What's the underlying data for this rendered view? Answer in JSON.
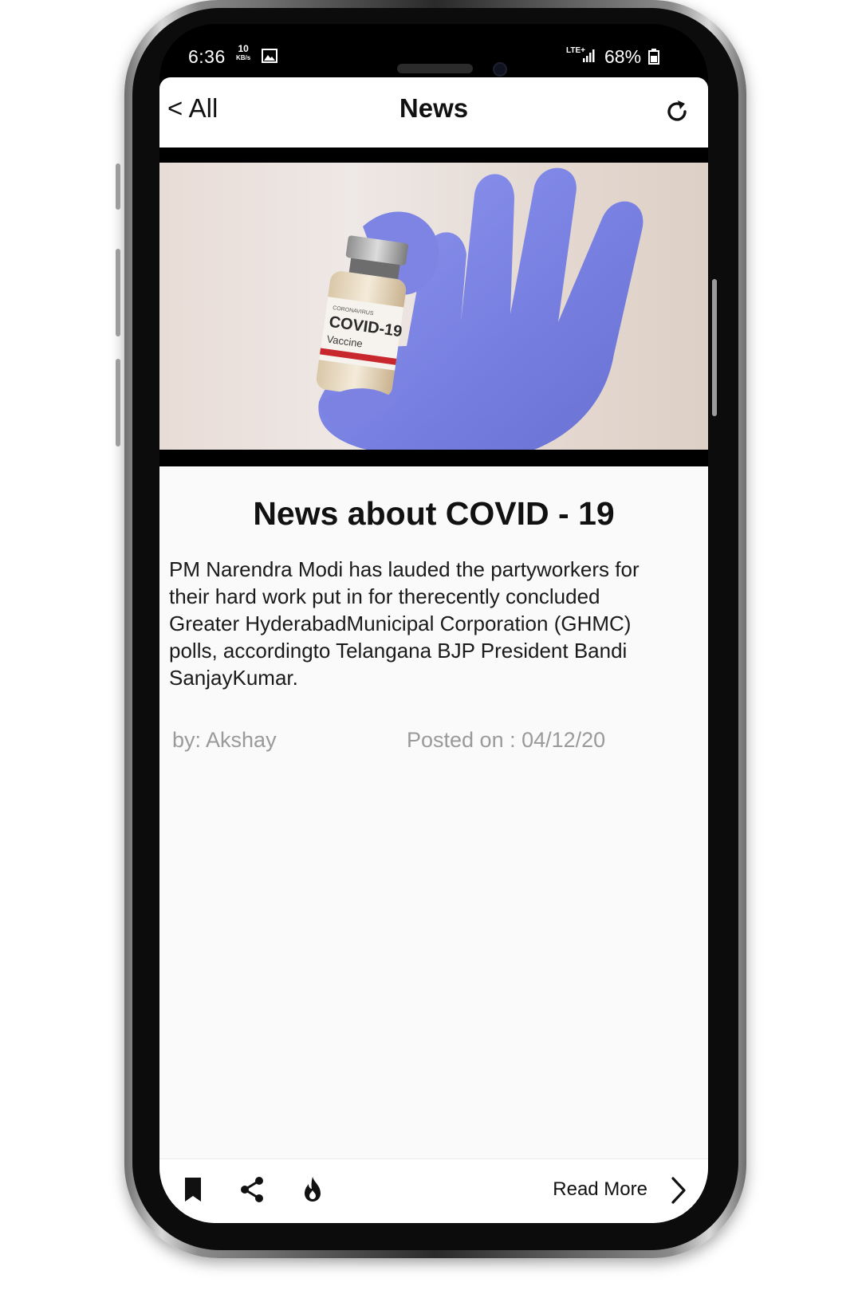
{
  "status_bar": {
    "time": "6:36",
    "speed_value": "10",
    "speed_unit": "KB/s",
    "network": "LTE+",
    "battery": "68%"
  },
  "app_bar": {
    "back_label": "< All",
    "title": "News",
    "refresh_icon": "refresh-icon"
  },
  "article": {
    "image_subject": "COVID-19 Vaccine",
    "vial_label_top": "CORONAVIRUS",
    "vial_label_main": "COVID-19",
    "vial_label_sub": "Vaccine",
    "headline": "News about COVID - 19",
    "body": "PM Narendra Modi has lauded the partyworkers for their hard work put in for therecently concluded Greater HyderabadMunicipal Corporation (GHMC) polls, accordingto Telangana BJP President Bandi SanjayKumar.",
    "author": "by: Akshay",
    "posted": "Posted on : 04/12/20"
  },
  "bottom_bar": {
    "bookmark_icon": "bookmark-icon",
    "share_icon": "share-icon",
    "fire_icon": "fire-icon",
    "read_more": "Read More",
    "chevron_icon": "chevron-right-icon"
  },
  "colors": {
    "glove": "#7f86e6",
    "frame": "#0c0c0c",
    "card_bg": "#fafafa",
    "meta_text": "#9a9a9a",
    "vial_band": "#c8272d"
  }
}
